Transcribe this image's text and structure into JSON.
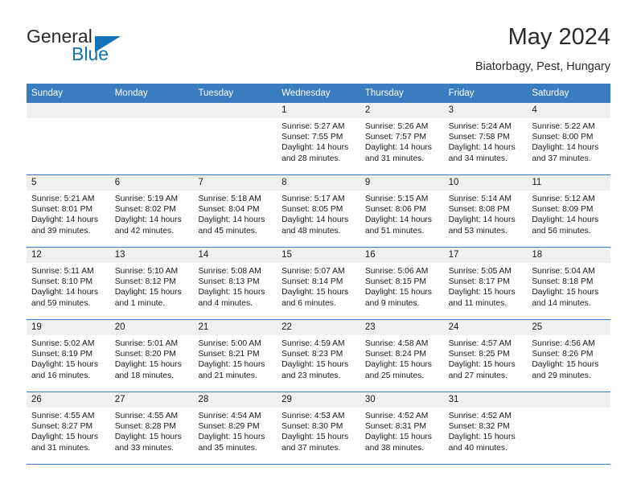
{
  "brand": {
    "name_top": "General",
    "name_bottom": "Blue",
    "triangle_icon": "triangle-icon",
    "colors": {
      "blue": "#1271b8",
      "dark": "#2b2b2b"
    }
  },
  "header": {
    "title": "May 2024",
    "subtitle": "Biatorbagy, Pest, Hungary"
  },
  "calendar": {
    "accent_color": "#3a7cc0",
    "day_band_color": "#f0f0f0",
    "weekdays": [
      "Sunday",
      "Monday",
      "Tuesday",
      "Wednesday",
      "Thursday",
      "Friday",
      "Saturday"
    ],
    "weeks": [
      [
        {
          "day": "",
          "empty": true
        },
        {
          "day": "",
          "empty": true
        },
        {
          "day": "",
          "empty": true
        },
        {
          "day": "1",
          "sunrise": "Sunrise: 5:27 AM",
          "sunset": "Sunset: 7:55 PM",
          "daylight": "Daylight: 14 hours and 28 minutes."
        },
        {
          "day": "2",
          "sunrise": "Sunrise: 5:26 AM",
          "sunset": "Sunset: 7:57 PM",
          "daylight": "Daylight: 14 hours and 31 minutes."
        },
        {
          "day": "3",
          "sunrise": "Sunrise: 5:24 AM",
          "sunset": "Sunset: 7:58 PM",
          "daylight": "Daylight: 14 hours and 34 minutes."
        },
        {
          "day": "4",
          "sunrise": "Sunrise: 5:22 AM",
          "sunset": "Sunset: 8:00 PM",
          "daylight": "Daylight: 14 hours and 37 minutes."
        }
      ],
      [
        {
          "day": "5",
          "sunrise": "Sunrise: 5:21 AM",
          "sunset": "Sunset: 8:01 PM",
          "daylight": "Daylight: 14 hours and 39 minutes."
        },
        {
          "day": "6",
          "sunrise": "Sunrise: 5:19 AM",
          "sunset": "Sunset: 8:02 PM",
          "daylight": "Daylight: 14 hours and 42 minutes."
        },
        {
          "day": "7",
          "sunrise": "Sunrise: 5:18 AM",
          "sunset": "Sunset: 8:04 PM",
          "daylight": "Daylight: 14 hours and 45 minutes."
        },
        {
          "day": "8",
          "sunrise": "Sunrise: 5:17 AM",
          "sunset": "Sunset: 8:05 PM",
          "daylight": "Daylight: 14 hours and 48 minutes."
        },
        {
          "day": "9",
          "sunrise": "Sunrise: 5:15 AM",
          "sunset": "Sunset: 8:06 PM",
          "daylight": "Daylight: 14 hours and 51 minutes."
        },
        {
          "day": "10",
          "sunrise": "Sunrise: 5:14 AM",
          "sunset": "Sunset: 8:08 PM",
          "daylight": "Daylight: 14 hours and 53 minutes."
        },
        {
          "day": "11",
          "sunrise": "Sunrise: 5:12 AM",
          "sunset": "Sunset: 8:09 PM",
          "daylight": "Daylight: 14 hours and 56 minutes."
        }
      ],
      [
        {
          "day": "12",
          "sunrise": "Sunrise: 5:11 AM",
          "sunset": "Sunset: 8:10 PM",
          "daylight": "Daylight: 14 hours and 59 minutes."
        },
        {
          "day": "13",
          "sunrise": "Sunrise: 5:10 AM",
          "sunset": "Sunset: 8:12 PM",
          "daylight": "Daylight: 15 hours and 1 minute."
        },
        {
          "day": "14",
          "sunrise": "Sunrise: 5:08 AM",
          "sunset": "Sunset: 8:13 PM",
          "daylight": "Daylight: 15 hours and 4 minutes."
        },
        {
          "day": "15",
          "sunrise": "Sunrise: 5:07 AM",
          "sunset": "Sunset: 8:14 PM",
          "daylight": "Daylight: 15 hours and 6 minutes."
        },
        {
          "day": "16",
          "sunrise": "Sunrise: 5:06 AM",
          "sunset": "Sunset: 8:15 PM",
          "daylight": "Daylight: 15 hours and 9 minutes."
        },
        {
          "day": "17",
          "sunrise": "Sunrise: 5:05 AM",
          "sunset": "Sunset: 8:17 PM",
          "daylight": "Daylight: 15 hours and 11 minutes."
        },
        {
          "day": "18",
          "sunrise": "Sunrise: 5:04 AM",
          "sunset": "Sunset: 8:18 PM",
          "daylight": "Daylight: 15 hours and 14 minutes."
        }
      ],
      [
        {
          "day": "19",
          "sunrise": "Sunrise: 5:02 AM",
          "sunset": "Sunset: 8:19 PM",
          "daylight": "Daylight: 15 hours and 16 minutes."
        },
        {
          "day": "20",
          "sunrise": "Sunrise: 5:01 AM",
          "sunset": "Sunset: 8:20 PM",
          "daylight": "Daylight: 15 hours and 18 minutes."
        },
        {
          "day": "21",
          "sunrise": "Sunrise: 5:00 AM",
          "sunset": "Sunset: 8:21 PM",
          "daylight": "Daylight: 15 hours and 21 minutes."
        },
        {
          "day": "22",
          "sunrise": "Sunrise: 4:59 AM",
          "sunset": "Sunset: 8:23 PM",
          "daylight": "Daylight: 15 hours and 23 minutes."
        },
        {
          "day": "23",
          "sunrise": "Sunrise: 4:58 AM",
          "sunset": "Sunset: 8:24 PM",
          "daylight": "Daylight: 15 hours and 25 minutes."
        },
        {
          "day": "24",
          "sunrise": "Sunrise: 4:57 AM",
          "sunset": "Sunset: 8:25 PM",
          "daylight": "Daylight: 15 hours and 27 minutes."
        },
        {
          "day": "25",
          "sunrise": "Sunrise: 4:56 AM",
          "sunset": "Sunset: 8:26 PM",
          "daylight": "Daylight: 15 hours and 29 minutes."
        }
      ],
      [
        {
          "day": "26",
          "sunrise": "Sunrise: 4:55 AM",
          "sunset": "Sunset: 8:27 PM",
          "daylight": "Daylight: 15 hours and 31 minutes."
        },
        {
          "day": "27",
          "sunrise": "Sunrise: 4:55 AM",
          "sunset": "Sunset: 8:28 PM",
          "daylight": "Daylight: 15 hours and 33 minutes."
        },
        {
          "day": "28",
          "sunrise": "Sunrise: 4:54 AM",
          "sunset": "Sunset: 8:29 PM",
          "daylight": "Daylight: 15 hours and 35 minutes."
        },
        {
          "day": "29",
          "sunrise": "Sunrise: 4:53 AM",
          "sunset": "Sunset: 8:30 PM",
          "daylight": "Daylight: 15 hours and 37 minutes."
        },
        {
          "day": "30",
          "sunrise": "Sunrise: 4:52 AM",
          "sunset": "Sunset: 8:31 PM",
          "daylight": "Daylight: 15 hours and 38 minutes."
        },
        {
          "day": "31",
          "sunrise": "Sunrise: 4:52 AM",
          "sunset": "Sunset: 8:32 PM",
          "daylight": "Daylight: 15 hours and 40 minutes."
        },
        {
          "day": "",
          "empty": true
        }
      ]
    ]
  }
}
